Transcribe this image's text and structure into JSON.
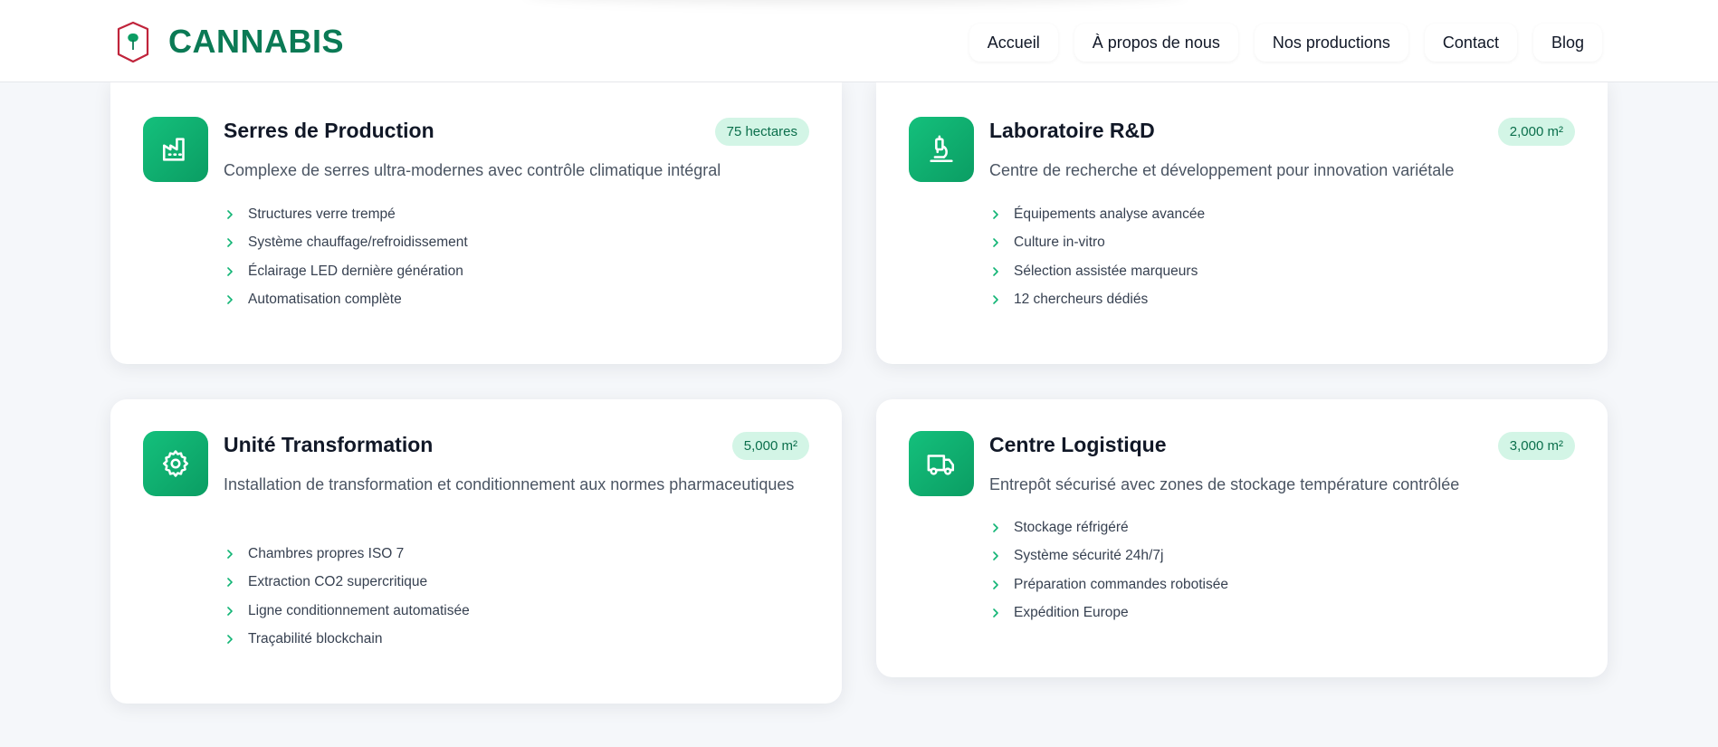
{
  "header": {
    "brand_name": "CANNABIS",
    "nav": [
      "Accueil",
      "À propos de nous",
      "Nos productions",
      "Contact",
      "Blog"
    ]
  },
  "colors": {
    "brand": "#0b7a55",
    "accent": "#10b474",
    "badge_bg": "#d3f5e6",
    "logo_red": "#c0243b"
  },
  "cards": [
    {
      "title": "Serres de Production",
      "badge": "75 hectares",
      "icon": "factory-icon",
      "description": "Complexe de serres ultra-modernes avec contrôle climatique intégral",
      "features": [
        "Structures verre trempé",
        "Système chauffage/refroidissement",
        "Éclairage LED dernière génération",
        "Automatisation complète"
      ]
    },
    {
      "title": "Laboratoire R&D",
      "badge": "2,000 m²",
      "icon": "microscope-icon",
      "description": "Centre de recherche et développement pour innovation variétale",
      "features": [
        "Équipements analyse avancée",
        "Culture in-vitro",
        "Sélection assistée marqueurs",
        "12 chercheurs dédiés"
      ]
    },
    {
      "title": "Unité Transformation",
      "badge": "5,000 m²",
      "icon": "gear-icon",
      "description": "Installation de transformation et conditionnement aux normes pharmaceutiques",
      "features": [
        "Chambres propres ISO 7",
        "Extraction CO2 supercritique",
        "Ligne conditionnement automatisée",
        "Traçabilité blockchain"
      ]
    },
    {
      "title": "Centre Logistique",
      "badge": "3,000 m²",
      "icon": "truck-icon",
      "description": "Entrepôt sécurisé avec zones de stockage température contrôlée",
      "features": [
        "Stockage réfrigéré",
        "Système sécurité 24h/7j",
        "Préparation commandes robotisée",
        "Expédition Europe"
      ]
    }
  ]
}
